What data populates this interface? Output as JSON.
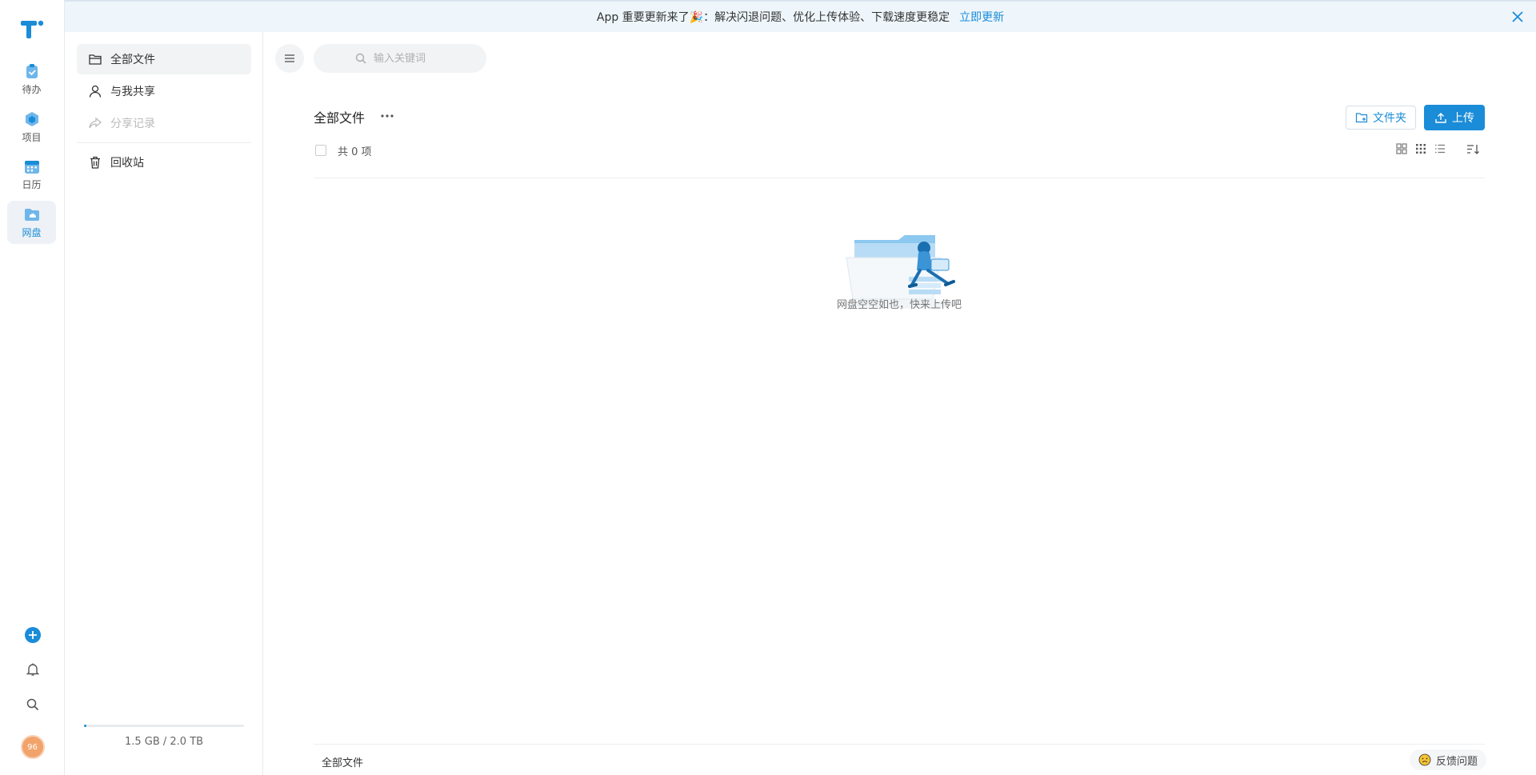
{
  "colors": {
    "accent": "#1a8cd8",
    "banner_bg": "#eef6fb",
    "avatar": "#f2a36b"
  },
  "rail": {
    "items": [
      {
        "label": "待办",
        "icon": "todo-icon"
      },
      {
        "label": "项目",
        "icon": "project-icon"
      },
      {
        "label": "日历",
        "icon": "calendar-icon"
      },
      {
        "label": "网盘",
        "icon": "cloud-drive-icon",
        "active": true
      }
    ],
    "avatar_text": "96"
  },
  "banner": {
    "text": "App 重要更新来了🎉：解决闪退问题、优化上传体验、下载速度更稳定",
    "link": "立即更新"
  },
  "sidebar": {
    "items": [
      {
        "label": "全部文件",
        "icon": "folder-icon",
        "active": true
      },
      {
        "label": "与我共享",
        "icon": "user-icon"
      },
      {
        "label": "分享记录",
        "icon": "share-icon",
        "disabled": true
      },
      {
        "label": "回收站",
        "icon": "trash-icon"
      }
    ],
    "storage": {
      "text": "1.5 GB / 2.0 TB",
      "fraction": 0.0008
    }
  },
  "main": {
    "search_placeholder": "输入关键词",
    "title": "全部文件",
    "new_folder_label": "文件夹",
    "upload_label": "上传",
    "count_text": "共 0 项",
    "empty_text": "网盘空空如也，快来上传吧",
    "footer_crumb": "全部文件",
    "feedback_label": "反馈问题"
  }
}
